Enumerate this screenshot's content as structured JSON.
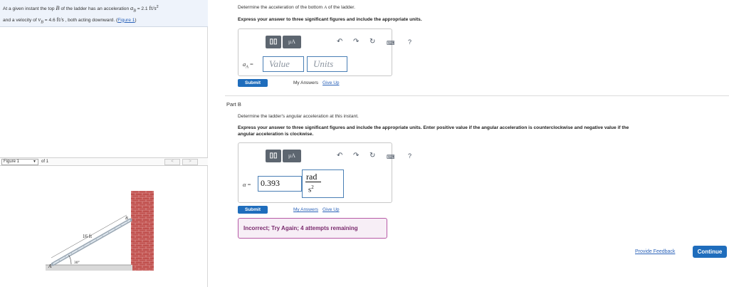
{
  "problem": {
    "t1": "At a given instant the top ",
    "B": "B",
    "t2": " of the ladder has an acceleration ",
    "aB": "a",
    "aBsub": "B",
    "t3": " = 2.1 ",
    "unitA": "ft/s",
    "unitAexp": "2",
    "t4": "and a velocity of ",
    "vB": "v",
    "vBsub": "B",
    "t5": " = 4.6 ",
    "unitV": "ft/s",
    "t6": " , both acting downward. (",
    "figlink": "Figure 1",
    "t7": ")"
  },
  "figure_nav": {
    "selected": "Figure 1",
    "caret": "▼",
    "of": "of 1",
    "prev": "<",
    "next": ">"
  },
  "figure": {
    "length_label": "16 ft",
    "angle_label": "30°",
    "point_a": "A",
    "point_b": "B"
  },
  "partA": {
    "instr1a": "Determine the acceleration of the bottom ",
    "instr1var": "A",
    "instr1b": " of the ladder.",
    "instr2": "Express your answer to three significant figures and include the appropriate units.",
    "var": "a",
    "varsub": "A",
    "eq": " =",
    "value_placeholder": "Value",
    "units_placeholder": "Units",
    "submit": "Submit",
    "my_answers": "My Answers",
    "give_up": "Give Up"
  },
  "partB": {
    "title": "Part B",
    "instr1": "Determine the ladder's angular acceleration at this instant.",
    "instr2a": "Express your answer to three significant figures and include the appropriate units. Enter positive value if the angular acceleration is counterclockwise and negative value if the",
    "instr2b": "angular acceleration is clockwise.",
    "var": "α",
    "eq": " =",
    "value": "0.393",
    "unit_num": "rad",
    "unit_den": "s",
    "unit_exp": "2",
    "submit": "Submit",
    "my_answers": "My Answers",
    "give_up": "Give Up",
    "feedback": "Incorrect; Try Again; 4 attempts remaining"
  },
  "toolbar": {
    "templates": "▯▯",
    "mu": "μA",
    "undo": "↶",
    "redo": "↷",
    "reset": "↻",
    "keyboard": "⌨",
    "help": "?"
  },
  "footer": {
    "provide_feedback": "Provide Feedback",
    "continue": "Continue"
  },
  "colors": {
    "accent": "#1f6dbc",
    "field_border": "#4a7fb5",
    "feedback_border": "#b65aa6",
    "feedback_bg": "#f7eef6",
    "brick": "#c0504d"
  },
  "icons": [
    "templates-icon",
    "mu-icon",
    "undo-icon",
    "redo-icon",
    "reset-icon",
    "keyboard-icon",
    "help-icon"
  ]
}
